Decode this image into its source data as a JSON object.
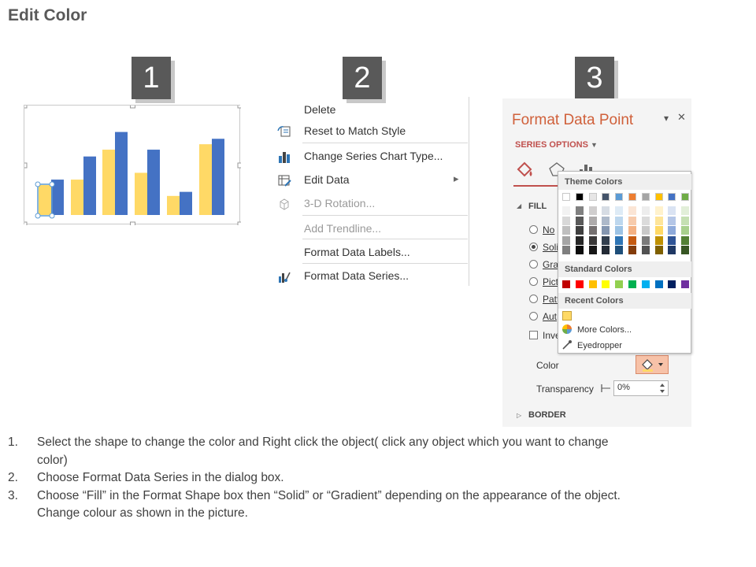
{
  "page": {
    "title": "Edit Color"
  },
  "steps": {
    "one": "1",
    "two": "2",
    "three": "3"
  },
  "chart": {
    "colors": {
      "series_yellow": "#ffd966",
      "series_blue": "#4472c4"
    },
    "values": [
      [
        0.22,
        0.26
      ],
      [
        0.26,
        0.43
      ],
      [
        0.48,
        0.61
      ],
      [
        0.31,
        0.48
      ],
      [
        0.14,
        0.17
      ],
      [
        0.52,
        0.56
      ]
    ]
  },
  "context_menu": {
    "items": [
      {
        "label": "Delete",
        "icon": "none-icon",
        "disabled": false
      },
      {
        "label": "Reset to Match Style",
        "icon": "reset-style-icon",
        "disabled": false
      },
      {
        "label": "Change Series Chart Type...",
        "icon": "bar-chart-icon",
        "disabled": false
      },
      {
        "label": "Edit Data",
        "icon": "edit-data-icon",
        "disabled": false,
        "has_submenu": true
      },
      {
        "label": "3-D Rotation...",
        "icon": "cube-icon",
        "disabled": true
      },
      {
        "label": "Add Trendline...",
        "icon": "none-icon",
        "disabled": true
      },
      {
        "label": "Format Data Labels...",
        "icon": "none-icon",
        "disabled": false
      },
      {
        "label": "Format Data Series...",
        "icon": "format-series-icon",
        "disabled": false
      }
    ]
  },
  "format_pane": {
    "title": "Format Data Point",
    "dropdown_glyph": "▾",
    "close_glyph": "✕",
    "series_options": "SERIES OPTIONS",
    "fill_header": "FILL",
    "border_header": "BORDER",
    "fill_options": [
      "No",
      "Soli",
      "Gra",
      "Pict",
      "Patt",
      "Aut"
    ],
    "selected_fill": 1,
    "invert_label": "Inve",
    "color_label": "Color",
    "transparency_label": "Transparency",
    "transparency_value": "0%"
  },
  "color_picker": {
    "theme_header": "Theme Colors",
    "standard_header": "Standard Colors",
    "recent_header": "Recent Colors",
    "more_colors": "More Colors...",
    "eyedropper": "Eyedropper",
    "theme_top": [
      "#ffffff",
      "#000000",
      "#e7e6e6",
      "#44546a",
      "#5b9bd5",
      "#ed7d31",
      "#a5a5a5",
      "#ffc000",
      "#4472c4",
      "#70ad47"
    ],
    "theme_shades": [
      [
        "#f2f2f2",
        "#808080",
        "#d0cece",
        "#d6dce4",
        "#deebf6",
        "#fbe5d5",
        "#ededed",
        "#fff2cc",
        "#dae3f3",
        "#e2efd9"
      ],
      [
        "#d8d8d8",
        "#595959",
        "#aeabab",
        "#adb9ca",
        "#bdd7ee",
        "#f7cbac",
        "#dbdbdb",
        "#fee599",
        "#b4c6e7",
        "#c5e0b3"
      ],
      [
        "#bfbfbf",
        "#3f3f3f",
        "#757070",
        "#8496b0",
        "#9cc3e5",
        "#f4b183",
        "#c9c9c9",
        "#ffd965",
        "#8eaadb",
        "#a8d08d"
      ],
      [
        "#a5a5a5",
        "#262626",
        "#3a3838",
        "#323f4f",
        "#2e75b5",
        "#c55a11",
        "#7b7b7b",
        "#bf9000",
        "#2f5496",
        "#538135"
      ],
      [
        "#7f7f7f",
        "#0c0c0c",
        "#171616",
        "#222a35",
        "#1e4e79",
        "#833c0b",
        "#525252",
        "#7f6000",
        "#1f3864",
        "#375623"
      ]
    ],
    "standard": [
      "#c00000",
      "#ff0000",
      "#ffc000",
      "#ffff00",
      "#92d050",
      "#00b050",
      "#00b0f0",
      "#0070c0",
      "#002060",
      "#7030a0"
    ],
    "recent": [
      "#ffd966"
    ]
  },
  "instructions": [
    {
      "num": "1.",
      "lines": [
        "Select the shape to change the color and Right click the object( click any object which you want to change",
        "color)"
      ]
    },
    {
      "num": "2.",
      "lines": [
        "Choose Format Data Series in the dialog box."
      ]
    },
    {
      "num": "3.",
      "lines": [
        "Choose “Fill” in the Format Shape box then “Solid” or “Gradient” depending on the appearance of the object.",
        "Change colour as shown in the picture."
      ]
    }
  ]
}
